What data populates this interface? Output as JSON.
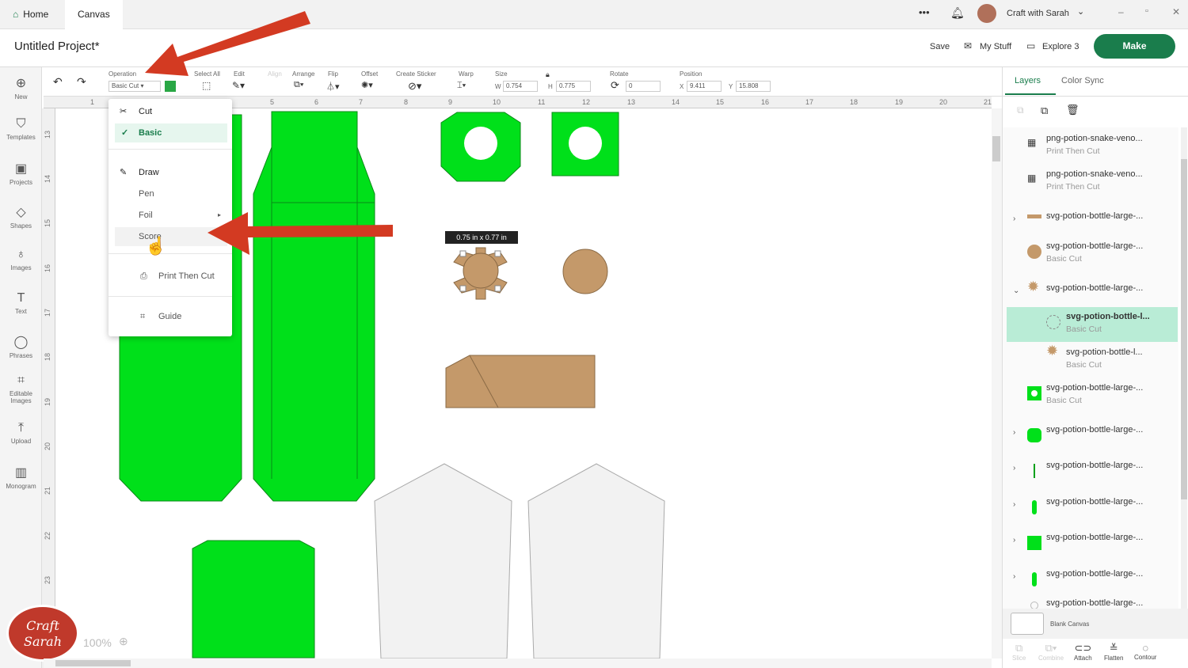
{
  "topbar": {
    "tabs": [
      "Home",
      "Canvas"
    ],
    "user": "Craft with Sarah",
    "more": "•••"
  },
  "header": {
    "title": "Untitled Project*",
    "save": "Save",
    "my_stuff": "My Stuff",
    "explore": "Explore 3",
    "make": "Make"
  },
  "toolbar": {
    "operation_label": "Operation",
    "operation_value": "Basic Cut",
    "select_all": "Select All",
    "edit": "Edit",
    "align": "Align",
    "arrange": "Arrange",
    "flip": "Flip",
    "offset": "Offset",
    "create_sticker": "Create Sticker",
    "warp": "Warp",
    "size": "Size",
    "w_label": "W",
    "w": "0.754",
    "h_label": "H",
    "h": "0.775",
    "rotate": "Rotate",
    "rotate_value": "0",
    "position": "Position",
    "x_label": "X",
    "x": "9.411",
    "y_label": "Y",
    "y": "15.808",
    "accent": "#29a745"
  },
  "sidebar": [
    "New",
    "Templates",
    "Projects",
    "Shapes",
    "Images",
    "Text",
    "Phrases",
    "Editable Images",
    "Upload",
    "Monogram"
  ],
  "ruler": {
    "h": [
      "1",
      "5",
      "6",
      "7",
      "8",
      "9",
      "10",
      "11",
      "12",
      "13",
      "14",
      "15",
      "16",
      "17",
      "18",
      "19",
      "20",
      "21"
    ],
    "v": [
      "13",
      "14",
      "15",
      "16",
      "17",
      "18",
      "19",
      "20",
      "21",
      "22",
      "23"
    ]
  },
  "dropdown": {
    "cut": "Cut",
    "basic": "Basic",
    "draw": "Draw",
    "pen": "Pen",
    "foil": "Foil",
    "score": "Score",
    "print_then_cut": "Print Then Cut",
    "guide": "Guide"
  },
  "canvas": {
    "size_tooltip": "0.75  in x 0.77  in",
    "zoom": "100%"
  },
  "logo": "Craft with Sarah",
  "panel": {
    "tabs": [
      "Layers",
      "Color Sync"
    ],
    "layers": [
      {
        "name": "png-potion-snake-veno...",
        "op": "Print Then Cut"
      },
      {
        "name": "png-potion-snake-veno...",
        "op": "Print Then Cut"
      },
      {
        "name": "svg-potion-bottle-large-...",
        "op": ""
      },
      {
        "name": "svg-potion-bottle-large-...",
        "op": "Basic Cut"
      },
      {
        "name": "svg-potion-bottle-large-...",
        "op": ""
      },
      {
        "name": "svg-potion-bottle-l...",
        "op": "Basic Cut"
      },
      {
        "name": "svg-potion-bottle-l...",
        "op": "Basic Cut"
      },
      {
        "name": "svg-potion-bottle-large-...",
        "op": "Basic Cut"
      },
      {
        "name": "svg-potion-bottle-large-...",
        "op": ""
      },
      {
        "name": "svg-potion-bottle-large-...",
        "op": ""
      },
      {
        "name": "svg-potion-bottle-large-...",
        "op": ""
      },
      {
        "name": "svg-potion-bottle-large-...",
        "op": ""
      },
      {
        "name": "svg-potion-bottle-large-...",
        "op": ""
      },
      {
        "name": "svg-potion-bottle-large-...",
        "op": ""
      }
    ],
    "blank_canvas": "Blank Canvas",
    "actions": [
      "Slice",
      "Combine",
      "Attach",
      "Flatten",
      "Contour"
    ]
  },
  "colors": {
    "green": "#00e01a",
    "brown": "#c4996a",
    "make": "#1a7d4c",
    "selected": "#b9ecd6",
    "arrow": "#d33a22"
  }
}
